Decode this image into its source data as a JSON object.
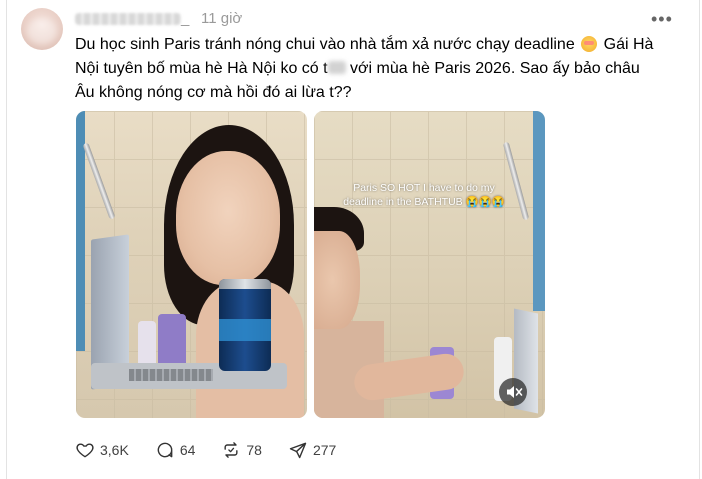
{
  "post": {
    "username": "_",
    "time": "11 giờ",
    "more_icon": "ellipsis-icon",
    "caption_line1": "Du học sinh Paris tránh nóng chui vào nhà tắm xả nước chạy deadline",
    "caption_line2a": "Gái Hà",
    "caption_line2b": "Nội tuyên bố mùa hè Hà Nội ko có t",
    "caption_line2c": "với mùa hè Paris 2026. Sao ấy bảo châu",
    "caption_line3": "Âu không nóng cơ mà hồi đó ai lừa t??",
    "emoji": "flushed-face-emoji"
  },
  "media": {
    "overlay_text_1": "Paris SO HOT I have to do my",
    "overlay_text_2": "deadline in the BATHTUB 😭😭😭",
    "mute_icon": "speaker-muted-icon"
  },
  "actions": {
    "likes": "3,6K",
    "comments": "64",
    "reposts": "78",
    "shares": "277"
  }
}
